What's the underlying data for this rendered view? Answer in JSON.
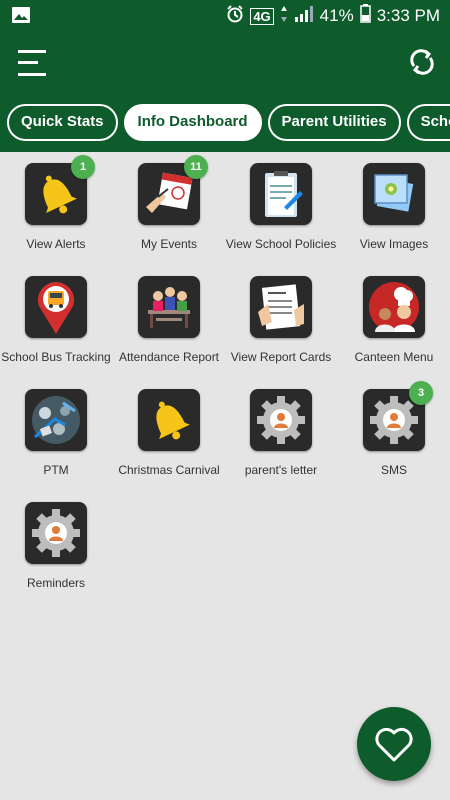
{
  "status_bar": {
    "network": "4G",
    "battery": "41%",
    "time": "3:33 PM"
  },
  "app_bar": {
    "menu_icon": "hamburger-menu-icon",
    "sync_icon": "sync-icon"
  },
  "tabs": [
    {
      "label": "Quick Stats",
      "active": false
    },
    {
      "label": "Info Dashboard",
      "active": true
    },
    {
      "label": "Parent Utilities",
      "active": false
    },
    {
      "label": "School U",
      "active": false
    }
  ],
  "tiles": [
    {
      "label": "View Alerts",
      "icon": "bell-icon",
      "badge": "1"
    },
    {
      "label": "My Events",
      "icon": "calendar-icon",
      "badge": "11"
    },
    {
      "label": "View School Policies",
      "icon": "policies-clipboard-icon",
      "badge": ""
    },
    {
      "label": "View Images",
      "icon": "images-icon",
      "badge": ""
    },
    {
      "label": "School Bus Tracking",
      "icon": "bus-location-icon",
      "badge": ""
    },
    {
      "label": "Attendance Report",
      "icon": "classroom-icon",
      "badge": ""
    },
    {
      "label": "View Report Cards",
      "icon": "report-card-icon",
      "badge": ""
    },
    {
      "label": "Canteen Menu",
      "icon": "chef-icon",
      "badge": ""
    },
    {
      "label": "PTM",
      "icon": "meeting-icon",
      "badge": ""
    },
    {
      "label": "Christmas Carnival",
      "icon": "bell-icon",
      "badge": ""
    },
    {
      "label": "parent's letter",
      "icon": "gear-person-icon",
      "badge": ""
    },
    {
      "label": "SMS",
      "icon": "gear-person-icon",
      "badge": "3"
    },
    {
      "label": "Reminders",
      "icon": "gear-person-icon",
      "badge": ""
    }
  ],
  "fab": {
    "icon": "heart-icon"
  },
  "colors": {
    "primary": "#0e5b2b",
    "badge": "#4caf50",
    "background": "#e5e5e5"
  }
}
